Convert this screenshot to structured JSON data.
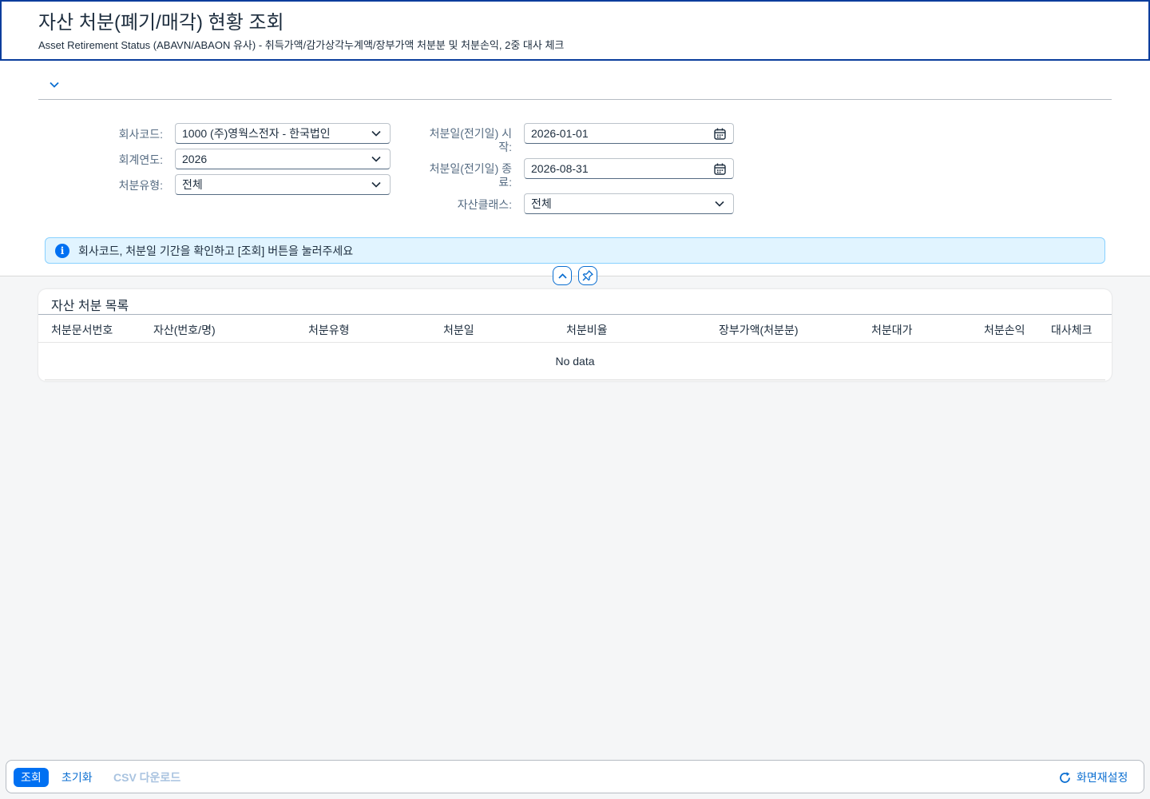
{
  "header": {
    "title": "자산 처분(폐기/매각) 현황 조회",
    "subtitle": "Asset Retirement Status (ABAVN/ABAON 유사) - 취득가액/감가상각누계액/장부가액 처분분 및 처분손익, 2중 대사 체크"
  },
  "filters": {
    "company_code": {
      "label": "회사코드:",
      "value": "1000 (주)영웍스전자 - 한국법인"
    },
    "fiscal_year": {
      "label": "회계연도:",
      "value": "2026"
    },
    "retirement_type": {
      "label": "처분유형:",
      "value": "전체"
    },
    "date_from": {
      "label_line1": "처분일(전기일) 시",
      "label_line2": "작:",
      "value": "2026-01-01"
    },
    "date_to": {
      "label_line1": "처분일(전기일) 종",
      "label_line2": "료:",
      "value": "2026-08-31"
    },
    "asset_class": {
      "label": "자산클래스:",
      "value": "전체"
    }
  },
  "info_message": "회사코드, 처분일 기간을 확인하고 [조회] 버튼을 눌러주세요",
  "table": {
    "title": "자산 처분 목록",
    "columns": [
      "처분문서번호",
      "자산(번호/명)",
      "처분유형",
      "처분일",
      "처분비율",
      "장부가액(처분분)",
      "처분대가",
      "처분손익",
      "대사체크"
    ],
    "empty_text": "No data"
  },
  "footer": {
    "search_label": "조회",
    "reset_label": "초기화",
    "csv_label": "CSV 다운로드",
    "layout_reset_label": "화면재설정"
  }
}
